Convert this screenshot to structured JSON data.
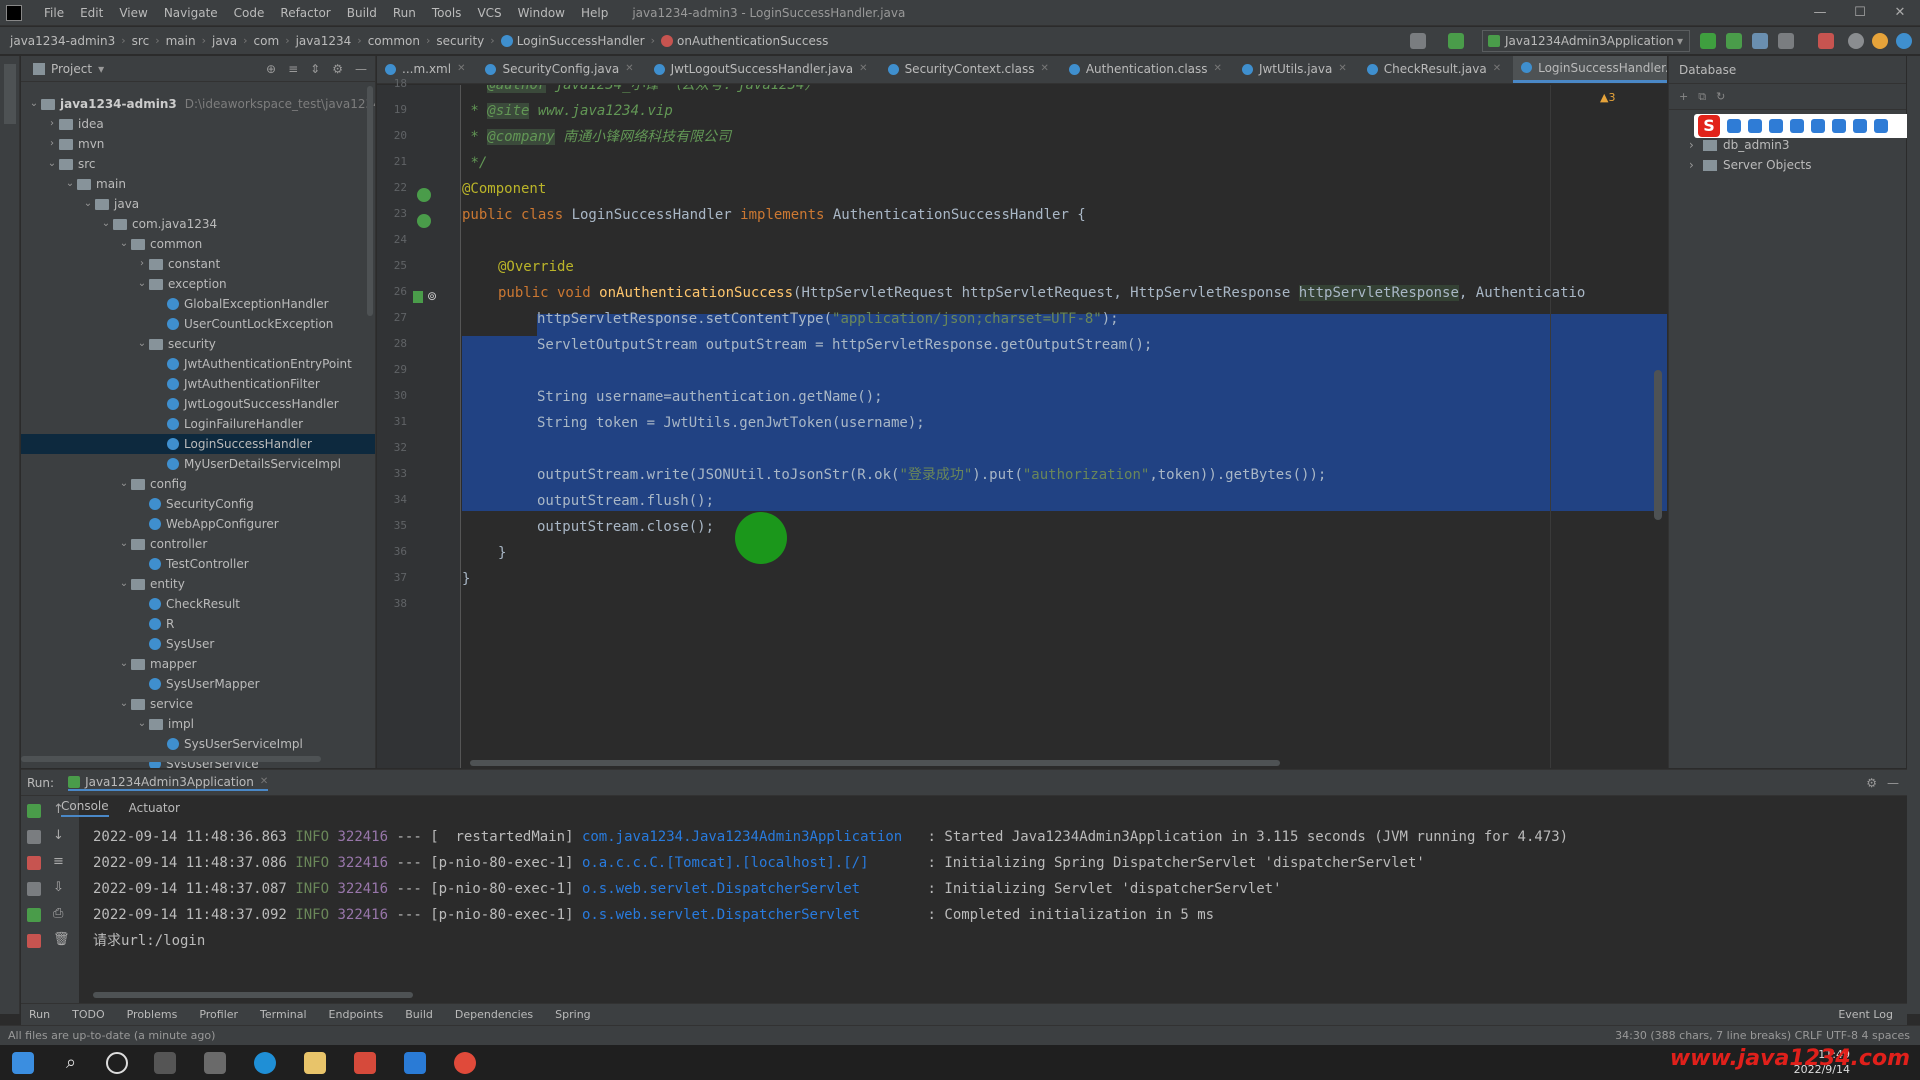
{
  "menubar": {
    "items": [
      "File",
      "Edit",
      "View",
      "Navigate",
      "Code",
      "Refactor",
      "Build",
      "Run",
      "Tools",
      "VCS",
      "Window",
      "Help"
    ],
    "window_title": "java1234-admin3 - LoginSuccessHandler.java"
  },
  "breadcrumbs": [
    "java1234-admin3",
    "src",
    "main",
    "java",
    "com",
    "java1234",
    "common",
    "security",
    "LoginSuccessHandler",
    "onAuthenticationSuccess"
  ],
  "run_config": "Java1234Admin3Application",
  "project_panel": {
    "title": "Project",
    "root_label": "java1234-admin3",
    "root_path": "D:\\ideaworkspace_test\\java1234...",
    "items": [
      {
        "label": "idea",
        "indent": 1,
        "type": "folder",
        "arrow": "›"
      },
      {
        "label": "mvn",
        "indent": 1,
        "type": "folder",
        "arrow": "›"
      },
      {
        "label": "src",
        "indent": 1,
        "type": "folder",
        "arrow": "⌄"
      },
      {
        "label": "main",
        "indent": 2,
        "type": "folder",
        "arrow": "⌄"
      },
      {
        "label": "java",
        "indent": 3,
        "type": "folder",
        "arrow": "⌄"
      },
      {
        "label": "com.java1234",
        "indent": 4,
        "type": "folder",
        "arrow": "⌄"
      },
      {
        "label": "common",
        "indent": 5,
        "type": "folder",
        "arrow": "⌄"
      },
      {
        "label": "constant",
        "indent": 6,
        "type": "folder",
        "arrow": "›"
      },
      {
        "label": "exception",
        "indent": 6,
        "type": "folder",
        "arrow": "⌄"
      },
      {
        "label": "GlobalExceptionHandler",
        "indent": 7,
        "type": "class",
        "arrow": ""
      },
      {
        "label": "UserCountLockException",
        "indent": 7,
        "type": "class",
        "arrow": ""
      },
      {
        "label": "security",
        "indent": 6,
        "type": "folder",
        "arrow": "⌄"
      },
      {
        "label": "JwtAuthenticationEntryPoint",
        "indent": 7,
        "type": "class",
        "arrow": ""
      },
      {
        "label": "JwtAuthenticationFilter",
        "indent": 7,
        "type": "class",
        "arrow": ""
      },
      {
        "label": "JwtLogoutSuccessHandler",
        "indent": 7,
        "type": "class",
        "arrow": ""
      },
      {
        "label": "LoginFailureHandler",
        "indent": 7,
        "type": "class",
        "arrow": ""
      },
      {
        "label": "LoginSuccessHandler",
        "indent": 7,
        "type": "class",
        "arrow": "",
        "selected": true
      },
      {
        "label": "MyUserDetailsServiceImpl",
        "indent": 7,
        "type": "class",
        "arrow": ""
      },
      {
        "label": "config",
        "indent": 5,
        "type": "folder",
        "arrow": "⌄"
      },
      {
        "label": "SecurityConfig",
        "indent": 6,
        "type": "class",
        "arrow": ""
      },
      {
        "label": "WebAppConfigurer",
        "indent": 6,
        "type": "class",
        "arrow": ""
      },
      {
        "label": "controller",
        "indent": 5,
        "type": "folder",
        "arrow": "⌄"
      },
      {
        "label": "TestController",
        "indent": 6,
        "type": "class",
        "arrow": ""
      },
      {
        "label": "entity",
        "indent": 5,
        "type": "folder",
        "arrow": "⌄"
      },
      {
        "label": "CheckResult",
        "indent": 6,
        "type": "class",
        "arrow": ""
      },
      {
        "label": "R",
        "indent": 6,
        "type": "class",
        "arrow": ""
      },
      {
        "label": "SysUser",
        "indent": 6,
        "type": "class",
        "arrow": ""
      },
      {
        "label": "mapper",
        "indent": 5,
        "type": "folder",
        "arrow": "⌄"
      },
      {
        "label": "SysUserMapper",
        "indent": 6,
        "type": "class",
        "arrow": ""
      },
      {
        "label": "service",
        "indent": 5,
        "type": "folder",
        "arrow": "⌄"
      },
      {
        "label": "impl",
        "indent": 6,
        "type": "folder",
        "arrow": "⌄"
      },
      {
        "label": "SysUserServiceImpl",
        "indent": 7,
        "type": "class",
        "arrow": ""
      },
      {
        "label": "SysUserService",
        "indent": 6,
        "type": "class",
        "arrow": ""
      }
    ]
  },
  "editor_tabs": [
    {
      "label": "...m.xml",
      "active": false
    },
    {
      "label": "SecurityConfig.java",
      "active": false
    },
    {
      "label": "JwtLogoutSuccessHandler.java",
      "active": false
    },
    {
      "label": "SecurityContext.class",
      "active": false
    },
    {
      "label": "Authentication.class",
      "active": false
    },
    {
      "label": "JwtUtils.java",
      "active": false
    },
    {
      "label": "CheckResult.java",
      "active": false
    },
    {
      "label": "LoginSuccessHandler.java",
      "active": true
    }
  ],
  "editor": {
    "warning_count": "3",
    "line_numbers": [
      "18",
      "19",
      "20",
      "21",
      "22",
      "23",
      "24",
      "25",
      "26",
      "27",
      "28",
      "29",
      "30",
      "31",
      "32",
      "33",
      "34",
      "35",
      "36",
      "37",
      "38"
    ],
    "lines": {
      "l18_tag": "@author",
      "l18_text": " java1234_小锋 （公众号：java1234）",
      "l19_tag": "@site",
      "l19_text": " www.java1234.vip",
      "l20_tag": "@company",
      "l20_text": " 南通小锋网络科技有限公司",
      "l21": "*/",
      "l22": "@Component",
      "l23_kw": "public class ",
      "l23_name": "LoginSuccessHandler ",
      "l23_impl": "implements ",
      "l23_rest": "AuthenticationSuccessHandler {",
      "l25": "@Override",
      "l26_kw": "public void ",
      "l26_fn": "onAuthenticationSuccess",
      "l26_rest1": "(HttpServletRequest httpServletRequest, HttpServletResponse ",
      "l26_param": "httpServletResponse",
      "l26_rest2": ", Authenticatio",
      "l27_pre": "httpServletResponse.setContentType(",
      "l27_str": "\"application/json;charset=UTF-8\"",
      "l27_post": ");",
      "l28": "ServletOutputStream outputStream = httpServletResponse.getOutputStream();",
      "l30": "String username=authentication.getName();",
      "l31": "String token = JwtUtils.genJwtToken(username);",
      "l33_pre": "outputStream.write(JSONUtil.toJsonStr(R.ok(",
      "l33_str1": "\"登录成功\"",
      "l33_mid": ").put(",
      "l33_str2": "\"authorization\"",
      "l33_post": ",token)).getBytes());",
      "l34": "outputStream.flush();",
      "l35": "outputStream.close();",
      "l36": "}",
      "l37": "}"
    }
  },
  "database_panel": {
    "title": "Database",
    "items": [
      "db_admin3",
      "Server Objects"
    ]
  },
  "run_panel": {
    "label": "Run:",
    "app_tab": "Java1234Admin3Application",
    "subtabs": [
      "Console",
      "Actuator"
    ],
    "logs": [
      {
        "time": "2022-09-14 11:48:36.863",
        "level": "INFO",
        "pid": "322416",
        "sep": " --- ",
        "thread": "[  restartedMain]",
        "logger": "com.java1234.Java1234Admin3Application",
        "msg": "  : Started Java1234Admin3Application in 3.115 seconds (JVM running for 4.473)"
      },
      {
        "time": "2022-09-14 11:48:37.086",
        "level": "INFO",
        "pid": "322416",
        "sep": " --- ",
        "thread": "[p-nio-80-exec-1]",
        "logger": "o.a.c.c.C.[Tomcat].[localhost].[/]",
        "msg": "      : Initializing Spring DispatcherServlet 'dispatcherServlet'"
      },
      {
        "time": "2022-09-14 11:48:37.087",
        "level": "INFO",
        "pid": "322416",
        "sep": " --- ",
        "thread": "[p-nio-80-exec-1]",
        "logger": "o.s.web.servlet.DispatcherServlet",
        "msg": "       : Initializing Servlet 'dispatcherServlet'"
      },
      {
        "time": "2022-09-14 11:48:37.092",
        "level": "INFO",
        "pid": "322416",
        "sep": " --- ",
        "thread": "[p-nio-80-exec-1]",
        "logger": "o.s.web.servlet.DispatcherServlet",
        "msg": "       : Completed initialization in 5 ms"
      }
    ],
    "last_line": "请求url:/login"
  },
  "tool_tabs": [
    "Run",
    "TODO",
    "Problems",
    "Profiler",
    "Terminal",
    "Endpoints",
    "Build",
    "Dependencies",
    "Spring"
  ],
  "event_log": "Event Log",
  "status": {
    "left": "All files are up-to-date (a minute ago)",
    "right": "34:30 (388 chars, 7 line breaks)   CRLF   UTF-8   4 spaces"
  },
  "taskbar": {
    "time": "11:49",
    "date": "2022/9/14"
  },
  "watermark": "www.java1234.com"
}
